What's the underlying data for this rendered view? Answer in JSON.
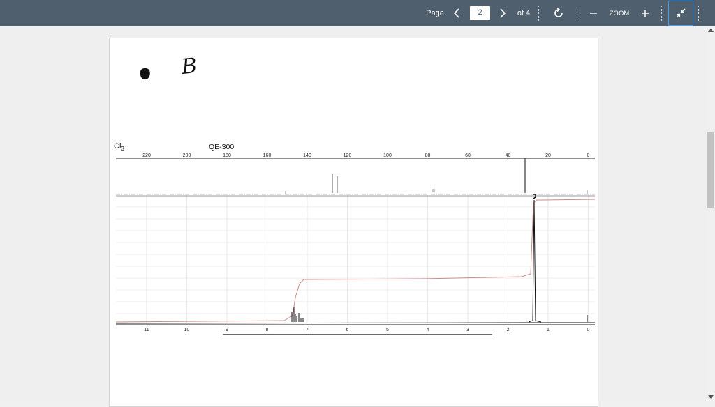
{
  "toolbar": {
    "page_label": "Page",
    "current_page": "2",
    "of_total": "of 4",
    "zoom_label": "ZOOM"
  },
  "document": {
    "handwritten_label": "B",
    "solvent_fragment": "Cl",
    "solvent_subscript": "3",
    "instrument": "QE-300",
    "c13_axis_ticks": [
      "220",
      "200",
      "180",
      "160",
      "140",
      "120",
      "100",
      "80",
      "60",
      "40",
      "20",
      "0"
    ],
    "h1_axis_ticks": [
      "11",
      "10",
      "9",
      "8",
      "7",
      "6",
      "5",
      "4",
      "3",
      "2",
      "1",
      "0"
    ]
  },
  "colors": {
    "toolbar_bg": "#4f5f6d",
    "focus_outline": "#3aa0ff",
    "integral_trace": "#c98a8a"
  }
}
